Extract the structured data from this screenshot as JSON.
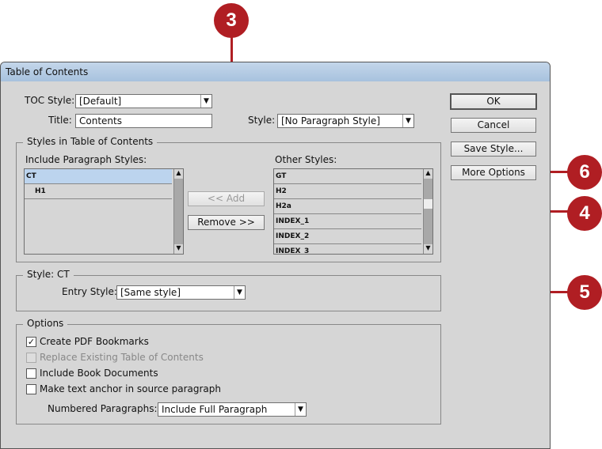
{
  "window": {
    "title": "Table of Contents"
  },
  "toc_style": {
    "label": "TOC Style:",
    "value": "[Default]"
  },
  "title_field": {
    "label": "Title:",
    "value": "Contents"
  },
  "style_field": {
    "label": "Style:",
    "value": "[No Paragraph Style]"
  },
  "styles_group": {
    "legend": "Styles in Table of Contents",
    "include_label": "Include Paragraph Styles:",
    "include_items": [
      "CT",
      "H1"
    ],
    "other_label": "Other Styles:",
    "other_items": [
      "GT",
      "H2",
      "H2a",
      "INDEX_1",
      "INDEX_2",
      "INDEX_3"
    ],
    "add_button": "<< Add",
    "remove_button": "Remove >>"
  },
  "style_group": {
    "legend": "Style: CT",
    "entry_label": "Entry Style:",
    "entry_value": "[Same style]"
  },
  "options": {
    "legend": "Options",
    "checks": [
      {
        "label": "Create PDF Bookmarks",
        "checked": true,
        "disabled": false
      },
      {
        "label": "Replace Existing Table of Contents",
        "checked": false,
        "disabled": true
      },
      {
        "label": "Include Book Documents",
        "checked": false,
        "disabled": false
      },
      {
        "label": "Make text anchor in source paragraph",
        "checked": false,
        "disabled": false
      }
    ],
    "numbered_label": "Numbered Paragraphs:",
    "numbered_value": "Include Full Paragraph"
  },
  "buttons": {
    "ok": "OK",
    "cancel": "Cancel",
    "save_style": "Save Style...",
    "more_options": "More Options"
  },
  "callouts": [
    "3",
    "4",
    "5",
    "6"
  ],
  "colors": {
    "callout": "#b01e23",
    "selection": "#bcd4ee"
  }
}
